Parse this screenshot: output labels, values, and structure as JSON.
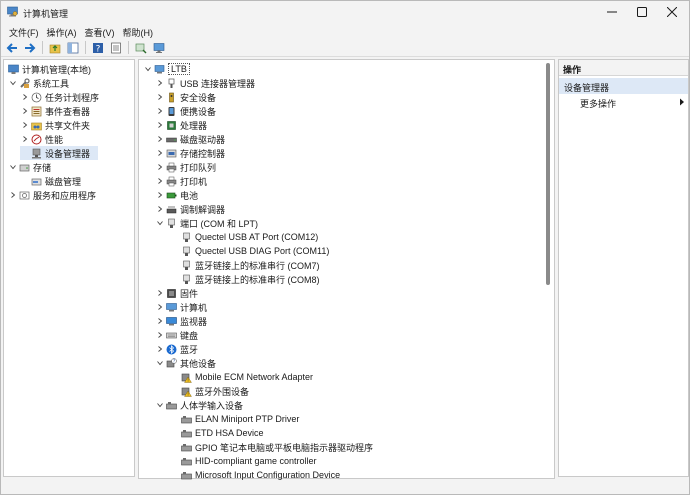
{
  "window": {
    "title": "计算机管理",
    "minimize_icon": "minimize-icon",
    "maximize_icon": "maximize-icon",
    "close_icon": "close-icon"
  },
  "menu": [
    "文件(F)",
    "操作(A)",
    "查看(V)",
    "帮助(H)"
  ],
  "toolbar": {
    "buttons": [
      "back-arrow-icon",
      "forward-arrow-icon",
      "folder-up-icon",
      "show-hide-tree-icon",
      "help-icon",
      "properties-icon",
      "refresh-icon",
      "monitor-icon"
    ]
  },
  "tree": {
    "root": "计算机管理(本地)",
    "items": [
      {
        "label": "系统工具",
        "level": 1,
        "expanded": true
      },
      {
        "label": "任务计划程序",
        "level": 2
      },
      {
        "label": "事件查看器",
        "level": 2
      },
      {
        "label": "共享文件夹",
        "level": 2
      },
      {
        "label": "性能",
        "level": 2
      },
      {
        "label": "设备管理器",
        "level": 2,
        "selected": true
      },
      {
        "label": "存储",
        "level": 1,
        "expanded": true
      },
      {
        "label": "磁盘管理",
        "level": 2
      },
      {
        "label": "服务和应用程序",
        "level": 1
      }
    ]
  },
  "devices": {
    "root": "LTB",
    "categories": [
      {
        "label": "USB 连接器管理器",
        "expanded": false
      },
      {
        "label": "安全设备",
        "expanded": false
      },
      {
        "label": "便携设备",
        "expanded": false
      },
      {
        "label": "处理器",
        "expanded": false
      },
      {
        "label": "磁盘驱动器",
        "expanded": false
      },
      {
        "label": "存储控制器",
        "expanded": false
      },
      {
        "label": "打印队列",
        "expanded": false
      },
      {
        "label": "打印机",
        "expanded": false
      },
      {
        "label": "电池",
        "expanded": false
      },
      {
        "label": "调制解调器",
        "expanded": false
      },
      {
        "label": "端口 (COM 和 LPT)",
        "expanded": true,
        "children": [
          "Quectel USB AT Port (COM12)",
          "Quectel USB DIAG Port (COM11)",
          "蓝牙链接上的标准串行 (COM7)",
          "蓝牙链接上的标准串行 (COM8)"
        ]
      },
      {
        "label": "固件",
        "expanded": false
      },
      {
        "label": "计算机",
        "expanded": false
      },
      {
        "label": "监视器",
        "expanded": false
      },
      {
        "label": "键盘",
        "expanded": false
      },
      {
        "label": "蓝牙",
        "expanded": false
      },
      {
        "label": "其他设备",
        "expanded": true,
        "children": [
          "Mobile ECM Network Adapter",
          "蓝牙外围设备"
        ]
      },
      {
        "label": "人体学输入设备",
        "expanded": true,
        "children": [
          "ELAN Miniport PTP Driver",
          "ETD HSA Device",
          "GPIO 笔记本电脑或平板电脑指示器驱动程序",
          "HID-compliant game controller",
          "Microsoft Input Configuration Device"
        ]
      }
    ]
  },
  "actions": {
    "header": "操作",
    "section": "设备管理器",
    "more": "更多操作"
  }
}
